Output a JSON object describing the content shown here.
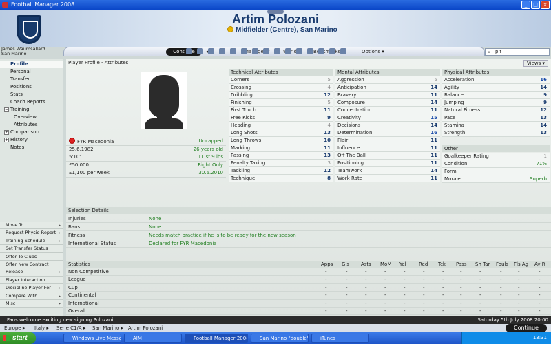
{
  "window": {
    "title": "Football Manager 2008"
  },
  "player": {
    "name": "Artim Polozani",
    "position": "Midfielder (Centre), San Marino"
  },
  "manager": {
    "name": "James Waumsallard",
    "club": "San Marino"
  },
  "nav": {
    "continue": "Continue",
    "manager": "Manager",
    "world": "World",
    "bookmarks": "Bookmarks",
    "options": "Options"
  },
  "search": {
    "value": "pit"
  },
  "sidebar": {
    "items": [
      "Profile",
      "Personal",
      "Transfer",
      "Positions",
      "Stats",
      "Coach Reports",
      "Training",
      "Overview",
      "Attributes",
      "Comparison",
      "History",
      "Notes"
    ],
    "actions": [
      "Move To",
      "Request Physio Report",
      "Training Schedule",
      "Set Transfer Status",
      "Offer To Clubs",
      "Offer New Contract",
      "Release",
      "Player Interaction",
      "Discipline Player For",
      "Compare With",
      "Misc"
    ]
  },
  "page": {
    "title": "Player Profile - Attributes",
    "views": "Views"
  },
  "bio": [
    {
      "label": "FYR Macedonia",
      "value": "Uncapped"
    },
    {
      "label": "25.6.1982",
      "value": "26 years old"
    },
    {
      "label": "5'10\"",
      "value": "11 st 9 lbs"
    },
    {
      "label": "£50,000",
      "value": "Right Only"
    },
    {
      "label": "£1,100 per week",
      "value": "30.6.2010"
    }
  ],
  "technical": {
    "title": "Technical Attributes",
    "rows": [
      {
        "n": "Corners",
        "v": "5"
      },
      {
        "n": "Crossing",
        "v": "4"
      },
      {
        "n": "Dribbling",
        "v": "12"
      },
      {
        "n": "Finishing",
        "v": "5"
      },
      {
        "n": "First Touch",
        "v": "11"
      },
      {
        "n": "Free Kicks",
        "v": "9"
      },
      {
        "n": "Heading",
        "v": "4"
      },
      {
        "n": "Long Shots",
        "v": "13"
      },
      {
        "n": "Long Throws",
        "v": "10"
      },
      {
        "n": "Marking",
        "v": "11"
      },
      {
        "n": "Passing",
        "v": "13"
      },
      {
        "n": "Penalty Taking",
        "v": "3"
      },
      {
        "n": "Tackling",
        "v": "12"
      },
      {
        "n": "Technique",
        "v": "8"
      }
    ]
  },
  "mental": {
    "title": "Mental Attributes",
    "rows": [
      {
        "n": "Aggression",
        "v": "5"
      },
      {
        "n": "Anticipation",
        "v": "14"
      },
      {
        "n": "Bravery",
        "v": "11"
      },
      {
        "n": "Composure",
        "v": "14"
      },
      {
        "n": "Concentration",
        "v": "11"
      },
      {
        "n": "Creativity",
        "v": "15"
      },
      {
        "n": "Decisions",
        "v": "14"
      },
      {
        "n": "Determination",
        "v": "16"
      },
      {
        "n": "Flair",
        "v": "11"
      },
      {
        "n": "Influence",
        "v": "11"
      },
      {
        "n": "Off The Ball",
        "v": "11"
      },
      {
        "n": "Positioning",
        "v": "11"
      },
      {
        "n": "Teamwork",
        "v": "14"
      },
      {
        "n": "Work Rate",
        "v": "11"
      }
    ]
  },
  "physical": {
    "title": "Physical Attributes",
    "rows": [
      {
        "n": "Acceleration",
        "v": "16"
      },
      {
        "n": "Agility",
        "v": "14"
      },
      {
        "n": "Balance",
        "v": "9"
      },
      {
        "n": "Jumping",
        "v": "9"
      },
      {
        "n": "Natural Fitness",
        "v": "12"
      },
      {
        "n": "Pace",
        "v": "13"
      },
      {
        "n": "Stamina",
        "v": "14"
      },
      {
        "n": "Strength",
        "v": "13"
      }
    ]
  },
  "other": {
    "title": "Other",
    "rows": [
      {
        "n": "Goalkeeper Rating",
        "v": "1"
      },
      {
        "n": "Condition",
        "v": "71%"
      },
      {
        "n": "Form",
        "v": ""
      },
      {
        "n": "Morale",
        "v": "Superb"
      }
    ]
  },
  "selection": {
    "title": "Selection Details",
    "rows": [
      {
        "n": "Injuries",
        "v": "None"
      },
      {
        "n": "Bans",
        "v": "None"
      },
      {
        "n": "Fitness",
        "v": "Needs match practice if he is to be ready for the new season"
      },
      {
        "n": "International Status",
        "v": "Declared for FYR Macedonia"
      }
    ]
  },
  "statistics": {
    "title": "Statistics",
    "columns": [
      "Apps",
      "Gls",
      "Asts",
      "MoM",
      "Yel",
      "Red",
      "Tck",
      "Pass",
      "Sh Tar",
      "Fouls",
      "Fls Ag",
      "Av R"
    ],
    "rows": [
      "Non Competitive",
      "League",
      "Cup",
      "Continental",
      "International",
      "Overall"
    ],
    "empty": "-"
  },
  "news": {
    "text": "Fans welcome exciting new signing Polozani",
    "date": "Saturday 5th July 2008 20:00"
  },
  "breadcrumbs": [
    "Europe",
    "Italy",
    "Serie C1/A",
    "San Marino",
    "Artim Polozani"
  ],
  "bottom": {
    "continue": "Continue"
  },
  "taskbar": {
    "start": "start",
    "tasks": [
      "Windows Live Messen...",
      "AIM",
      "Football Manager 2008",
      "San Marino \"double\" ...",
      "iTunes"
    ],
    "clock": "13:31"
  }
}
